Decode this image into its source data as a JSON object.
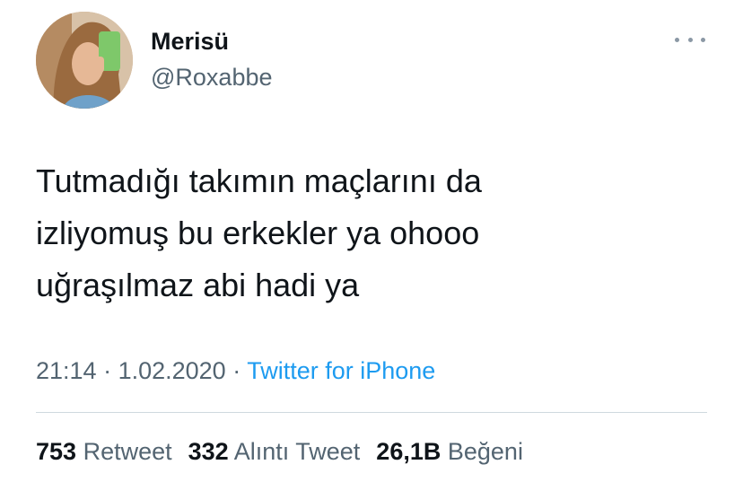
{
  "author": {
    "display_name": "Merisü",
    "handle": "@Roxabbe",
    "avatar_icon": "profile-photo"
  },
  "tweet": {
    "lines": [
      "Tutmadığı takımın maçlarını da",
      "izliyomuş bu erkekler ya ohooo",
      "uğraşılmaz abi hadi ya"
    ]
  },
  "meta": {
    "time": "21:14",
    "separator1": " · ",
    "date": "1.02.2020",
    "separator2": " · ",
    "source": "Twitter for iPhone"
  },
  "stats": {
    "retweets": {
      "count": "753",
      "label": "Retweet"
    },
    "quotes": {
      "count": "332",
      "label": "Alıntı Tweet"
    },
    "likes": {
      "count": "26,1B",
      "label": "Beğeni"
    }
  },
  "colors": {
    "text": "#0f1419",
    "secondary": "#536471",
    "link": "#1d9bf0",
    "divider": "#cfd9de"
  }
}
